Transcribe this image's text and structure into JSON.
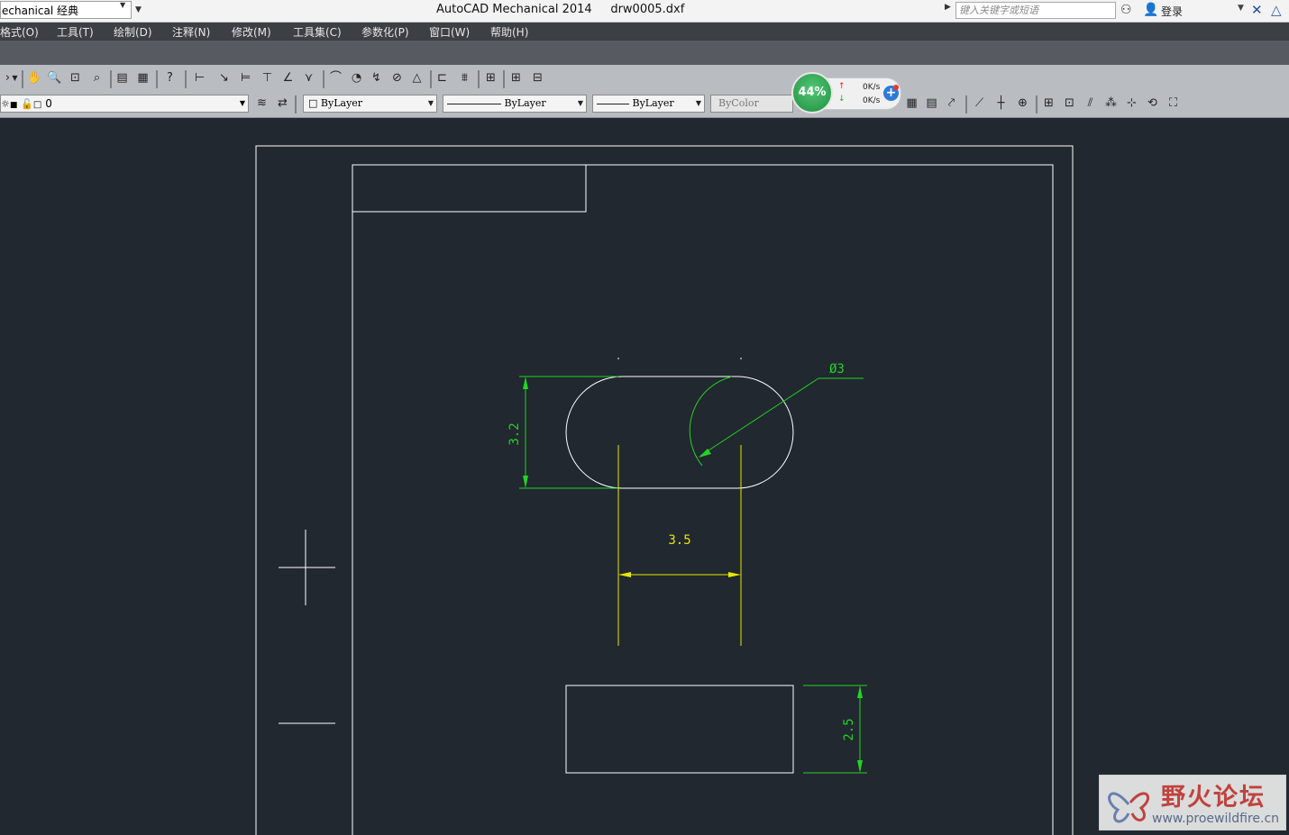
{
  "titlebar": {
    "workspace": "echanical 经典",
    "app_title": "AutoCAD Mechanical 2014",
    "file_name": "drw0005.dxf",
    "search_placeholder": "键入关键字或短语",
    "login": "登录"
  },
  "menubar": {
    "items": [
      {
        "label": "格式(O)",
        "name": "menu-format"
      },
      {
        "label": "工具(T)",
        "name": "menu-tools"
      },
      {
        "label": "绘制(D)",
        "name": "menu-draw"
      },
      {
        "label": "注释(N)",
        "name": "menu-annotate"
      },
      {
        "label": "修改(M)",
        "name": "menu-modify"
      },
      {
        "label": "工具集(C)",
        "name": "menu-toolsets"
      },
      {
        "label": "参数化(P)",
        "name": "menu-parametric"
      },
      {
        "label": "窗口(W)",
        "name": "menu-window"
      },
      {
        "label": "帮助(H)",
        "name": "menu-help"
      }
    ]
  },
  "properties": {
    "layer": "0",
    "color": "ByLayer",
    "linetype": "ByLayer",
    "lineweight": "ByLayer",
    "plotstyle": "ByColor"
  },
  "net_monitor": {
    "percent": "44%",
    "up_rate": "0K/s",
    "down_rate": "0K/s"
  },
  "drawing": {
    "dim_height": "3.2",
    "dim_width": "3.5",
    "dim_diameter": "Ø3",
    "dim_rect_height": "2.5",
    "colors": {
      "background": "#212830",
      "geometry": "#ffffff",
      "dim_green": "#22d422",
      "dim_yellow": "#e8e800"
    }
  },
  "watermark": {
    "title": "野火论坛",
    "url": "www.proewildfire.cn"
  }
}
